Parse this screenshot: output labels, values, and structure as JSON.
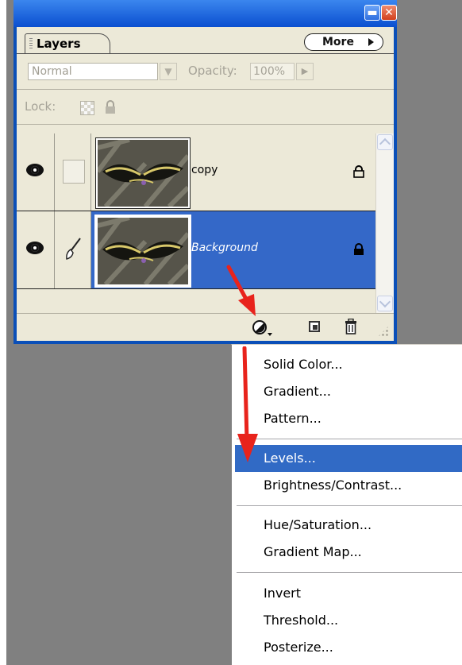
{
  "palette": {
    "tab_label": "Layers",
    "more_label": "More",
    "blend_mode": "Normal",
    "opacity_label": "Opacity:",
    "opacity_value": "100%",
    "lock_label": "Lock:"
  },
  "layers": [
    {
      "name": "copy",
      "selected": false
    },
    {
      "name": "Background",
      "selected": true
    }
  ],
  "menu": {
    "items": [
      {
        "label": "Solid Color..."
      },
      {
        "label": "Gradient..."
      },
      {
        "label": "Pattern..."
      },
      {
        "label": "Levels...",
        "highlighted": true
      },
      {
        "label": "Brightness/Contrast..."
      },
      {
        "label": "Hue/Saturation..."
      },
      {
        "label": "Gradient Map..."
      },
      {
        "label": "Invert"
      },
      {
        "label": "Threshold..."
      },
      {
        "label": "Posterize..."
      }
    ]
  },
  "colors": {
    "title_bar": "#0a4fd0",
    "selection": "#3468c8",
    "menu_highlight": "#316ac5",
    "annotation_arrow": "#e8231c"
  }
}
